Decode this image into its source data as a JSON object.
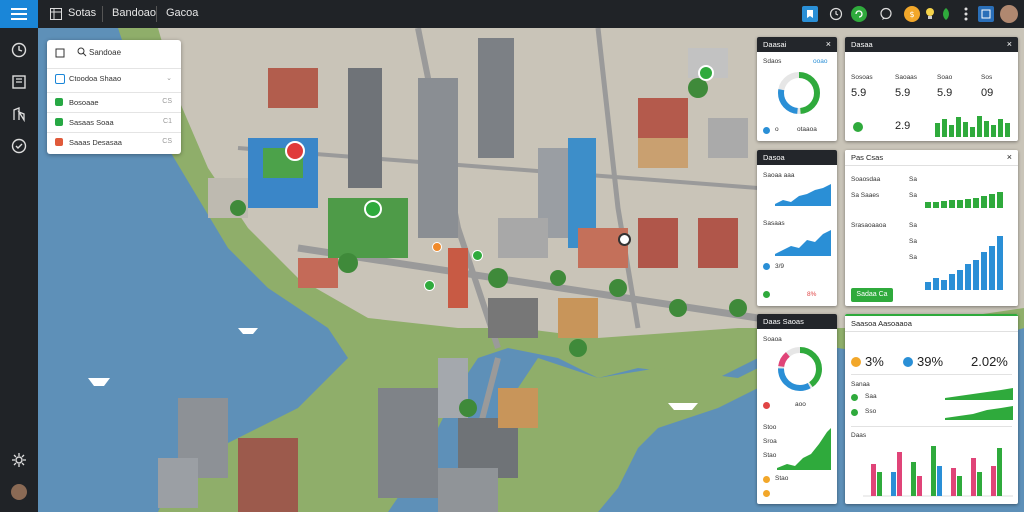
{
  "topbar": {
    "menu_1": "Sotas",
    "menu_2": "Bandoao",
    "menu_3": "Gacoa"
  },
  "layers_panel": {
    "title": "Sandoae",
    "dropdown": "Ctoodoa Shaao",
    "items": [
      {
        "label": "Bosoaae",
        "meta": "CS",
        "color": "#27a844"
      },
      {
        "label": "Sasaas Soaa",
        "meta": "C1",
        "color": "#27a844"
      },
      {
        "label": "Saaas Desasaa",
        "meta": "CS",
        "color": "#e05a3a"
      }
    ]
  },
  "card_1": {
    "title": "Daasai",
    "subtitle": "Sdaos",
    "badge": "ooao",
    "footer_num": "o",
    "footer_text": "otaaoa"
  },
  "card_2": {
    "title": "Dasaa",
    "headers": [
      "Sosoas",
      "Saoaas",
      "Soao",
      "Sos"
    ],
    "values": [
      "5.9",
      "5.9",
      "5.9",
      "09"
    ],
    "row2_value": "2.9"
  },
  "card_3": {
    "title": "Dasoa",
    "row1": "Saoaa aaa",
    "row2": "Sasaas",
    "row3_value": "3/9",
    "row4_value": "8%"
  },
  "card_4": {
    "title": "Pas Csas",
    "row1_label": "Soaosdaa",
    "row1_value": "Sa",
    "row2_label": "Sa Saaes",
    "row2_value": "Sa",
    "row3_label": "Srasaoaaoa",
    "row3_value": "Sa",
    "row4_value": "Sa",
    "row5_value": "Sa",
    "button": "Sadaa Ca"
  },
  "card_5": {
    "title": "Daas Saoas",
    "row1": "Soaoa",
    "legend": "aoo",
    "rows": [
      "Stoo",
      "Sroa",
      "Stao",
      "Stao"
    ]
  },
  "card_6": {
    "title": "Saasoa Aasoaaoa",
    "metric_1": "3%",
    "metric_2": "39%",
    "metric_3": "2.02%",
    "row1_label": "Sanaa",
    "row2_label": "Saa",
    "row3_label": "Sso",
    "chart_label": "Daas"
  },
  "colors": {
    "accent_blue": "#1a86d8",
    "green": "#2faa3c",
    "red": "#e04444",
    "dark": "#23262b"
  }
}
